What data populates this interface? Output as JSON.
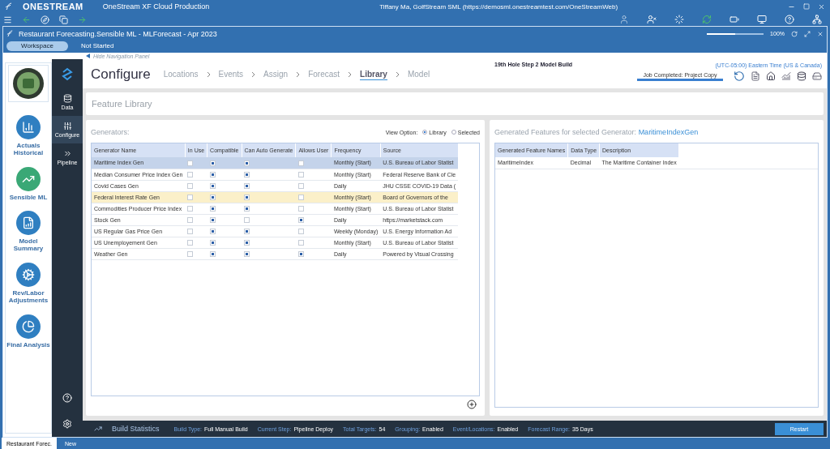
{
  "app_bar": {
    "brand": "ONESTREAM",
    "title": "OneStream XF Cloud Production",
    "user": "Tiffany Ma, GolfStream SML (https://demosml.onestreamtest.com/OneStreamWeb)"
  },
  "workspace": {
    "title": "Restaurant Forecasting.Sensible ML  -  MLForecast  -  Apr 2023",
    "zoom": "100%",
    "zoom_slider": {
      "level": 0.5
    },
    "button": "Workspace",
    "status": "Not Started"
  },
  "nav_panel": {
    "hide_label": "Hide Navigation Panel",
    "items": [
      {
        "label": "Actuals Historical",
        "color": "#2f7fc1"
      },
      {
        "label": "Sensible ML",
        "color": "#3aa876"
      },
      {
        "label": "Model Summary",
        "color": "#2f7fc1"
      },
      {
        "label": "Rev/Labor Adjustments",
        "color": "#2f7fc1"
      },
      {
        "label": "Final Analysis",
        "color": "#2f7fc1"
      }
    ]
  },
  "side_menu": [
    {
      "label": "Data",
      "selected": false
    },
    {
      "label": "Configure",
      "selected": true
    },
    {
      "label": "Pipeline",
      "selected": false
    }
  ],
  "header": {
    "title": "Configure",
    "project": "19th Hole Step 2 Model Build",
    "timezone": "(UTC-05:00) Eastern Time (US & Canada)",
    "job": {
      "label": "Job Completed: Project Copy",
      "level": 1
    },
    "steps": [
      {
        "label": "Locations",
        "selected": false
      },
      {
        "label": "Events",
        "selected": false
      },
      {
        "label": "Assign",
        "selected": false
      },
      {
        "label": "Forecast",
        "selected": false
      },
      {
        "label": "Library",
        "selected": true
      },
      {
        "label": "Model",
        "selected": false
      }
    ]
  },
  "feature_library": {
    "title": "Feature Library"
  },
  "generators": {
    "title": "Generators:",
    "view_label": "View Option:",
    "options": [
      {
        "label": "Library",
        "selected": true
      },
      {
        "label": "Selected",
        "selected": false
      }
    ],
    "columns": [
      "Generator Name",
      "In Use",
      "Compatible",
      "Can Auto Generate",
      "Allows User",
      "Frequency",
      "Source"
    ],
    "rows": [
      {
        "name": "Maritime Index Gen",
        "in_use": false,
        "compatible": true,
        "auto": true,
        "allows_user": false,
        "frequency": "Monthly (Start)",
        "source": "U.S. Bureau of Labor Statist",
        "selected": true,
        "highlighted": false
      },
      {
        "name": "Median Consumer Price Index Gen",
        "in_use": false,
        "compatible": true,
        "auto": true,
        "allows_user": false,
        "frequency": "Monthly (Start)",
        "source": "Federal Reserve Bank of Cle",
        "selected": false,
        "highlighted": false
      },
      {
        "name": "Covid Cases Gen",
        "in_use": false,
        "compatible": true,
        "auto": true,
        "allows_user": false,
        "frequency": "Daily",
        "source": "JHU CSSE COVID-19 Data (",
        "selected": false,
        "highlighted": false
      },
      {
        "name": "Federal Interest Rate Gen",
        "in_use": false,
        "compatible": true,
        "auto": true,
        "allows_user": false,
        "frequency": "Monthly (Start)",
        "source": "Board of Governors of the",
        "selected": false,
        "highlighted": true
      },
      {
        "name": "Commodities Producer Price Index",
        "in_use": false,
        "compatible": true,
        "auto": true,
        "allows_user": false,
        "frequency": "Monthly (Start)",
        "source": "U.S. Bureau of Labor Statist",
        "selected": false,
        "highlighted": false
      },
      {
        "name": "Stock Gen",
        "in_use": false,
        "compatible": true,
        "auto": false,
        "allows_user": true,
        "frequency": "Daily",
        "source": "https://marketstack.com",
        "selected": false,
        "highlighted": false
      },
      {
        "name": "US Regular Gas Price Gen",
        "in_use": false,
        "compatible": true,
        "auto": true,
        "allows_user": false,
        "frequency": "Weekly (Monday)",
        "source": "U.S. Energy Information Ad",
        "selected": false,
        "highlighted": false
      },
      {
        "name": "US Unemployement Gen",
        "in_use": false,
        "compatible": true,
        "auto": true,
        "allows_user": false,
        "frequency": "Monthly (Start)",
        "source": "U.S. Bureau of Labor Statist",
        "selected": false,
        "highlighted": false
      },
      {
        "name": "Weather Gen",
        "in_use": false,
        "compatible": true,
        "auto": true,
        "allows_user": true,
        "frequency": "Daily",
        "source": "Powered by Visual Crossing",
        "selected": false,
        "highlighted": false
      }
    ]
  },
  "generated": {
    "title": "Generated Features for selected Generator:",
    "generator": "MaritimeIndexGen",
    "columns": [
      "Generated Feature Names",
      "Data Type",
      "Description"
    ],
    "rows": [
      [
        "MaritimeIndex",
        "Decimal",
        "The Maritime Container Index"
      ]
    ]
  },
  "build_statistics": {
    "title": "Build Statistics",
    "items": [
      {
        "label": "Build Type:",
        "value": "Full Manual Build"
      },
      {
        "label": "Current Step:",
        "value": "Pipeline Deploy"
      },
      {
        "label": "Total Targets:",
        "value": "54"
      },
      {
        "label": "Grouping:",
        "value": "Enabled"
      },
      {
        "label": "Event/Locations:",
        "value": "Enabled"
      },
      {
        "label": "Forecast Range:",
        "value": "35 Days"
      }
    ],
    "button": "Restart"
  },
  "bottom_tabs": [
    {
      "label": "Restaurant Forec.",
      "selected": true
    },
    {
      "label": "New",
      "selected": false
    }
  ]
}
